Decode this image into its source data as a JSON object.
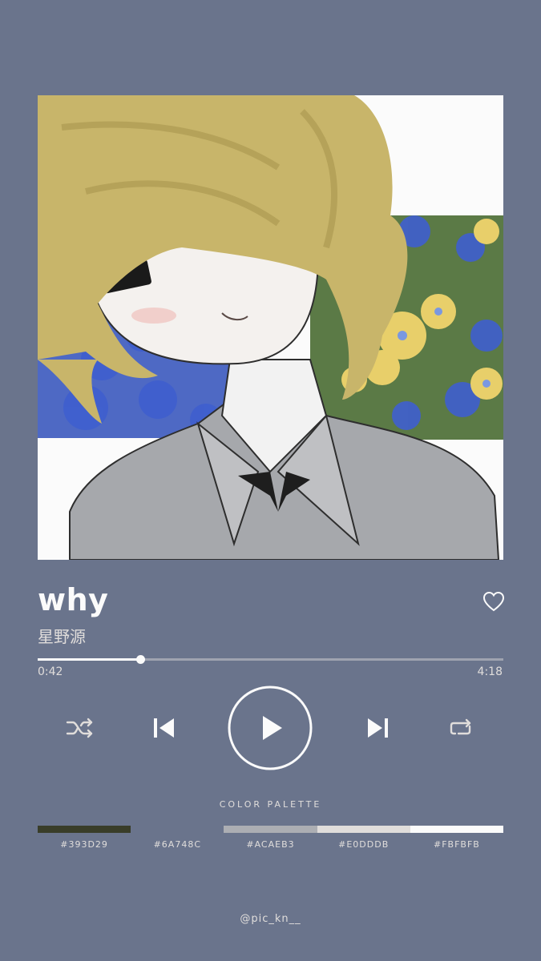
{
  "track": {
    "title": "why",
    "artist": "星野源"
  },
  "player": {
    "elapsed": "0:42",
    "total": "4:18",
    "progress": 0.22
  },
  "controls": [
    "shuffle-icon",
    "previous-icon",
    "play-icon",
    "next-icon",
    "repeat-icon",
    "heart-icon"
  ],
  "palette": {
    "title": "COLOR PALETTE",
    "colors": [
      "#393D29",
      "#6A748C",
      "#ACAEB3",
      "#E0DDDB",
      "#FBFBFB"
    ]
  },
  "credit": "@pic_kn__",
  "theme": {
    "background": "#6A748C",
    "foreground": "#FBFBFB"
  }
}
